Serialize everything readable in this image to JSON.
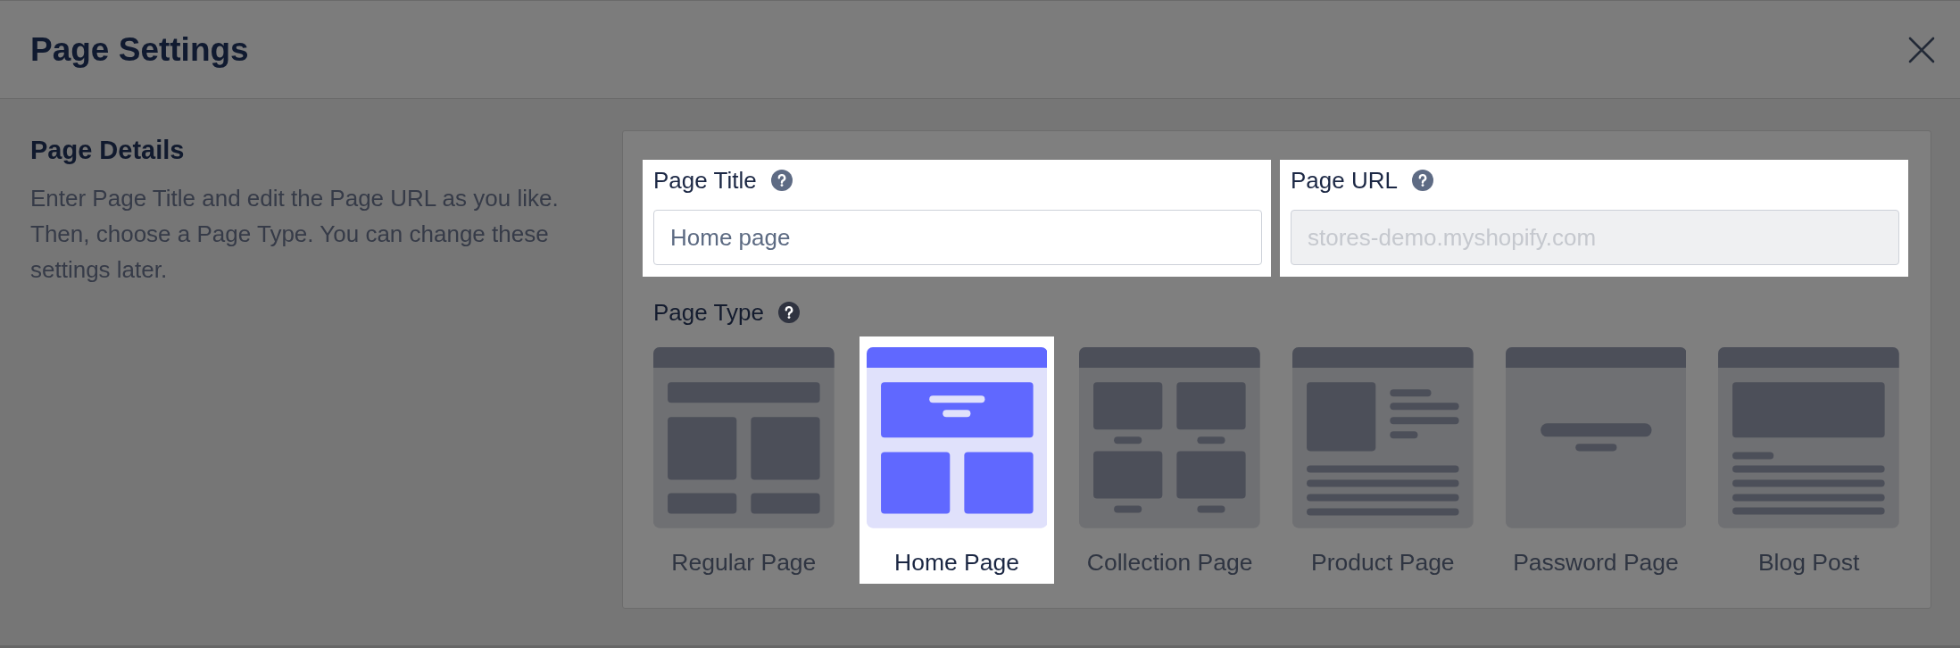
{
  "dialog": {
    "title": "Page Settings"
  },
  "details": {
    "heading": "Page Details",
    "description": "Enter Page Title and edit the Page URL as you like. Then, choose a Page Type. You can change these settings later."
  },
  "fields": [
    {
      "label": "Page Title",
      "value": "Home page",
      "disabled": false,
      "highlighted": true
    },
    {
      "label": "Page URL",
      "value": "stores-demo.myshopify.com",
      "disabled": true,
      "highlighted": true
    }
  ],
  "page_type": {
    "label": "Page Type",
    "options": [
      {
        "label": "Regular Page",
        "kind": "regular",
        "selected": false,
        "highlighted": false
      },
      {
        "label": "Home Page",
        "kind": "home",
        "selected": true,
        "highlighted": true
      },
      {
        "label": "Collection Page",
        "kind": "collection",
        "selected": false,
        "highlighted": false
      },
      {
        "label": "Product Page",
        "kind": "product",
        "selected": false,
        "highlighted": false
      },
      {
        "label": "Password Page",
        "kind": "password",
        "selected": false,
        "highlighted": false
      },
      {
        "label": "Blog Post",
        "kind": "blog",
        "selected": false,
        "highlighted": false
      }
    ]
  }
}
